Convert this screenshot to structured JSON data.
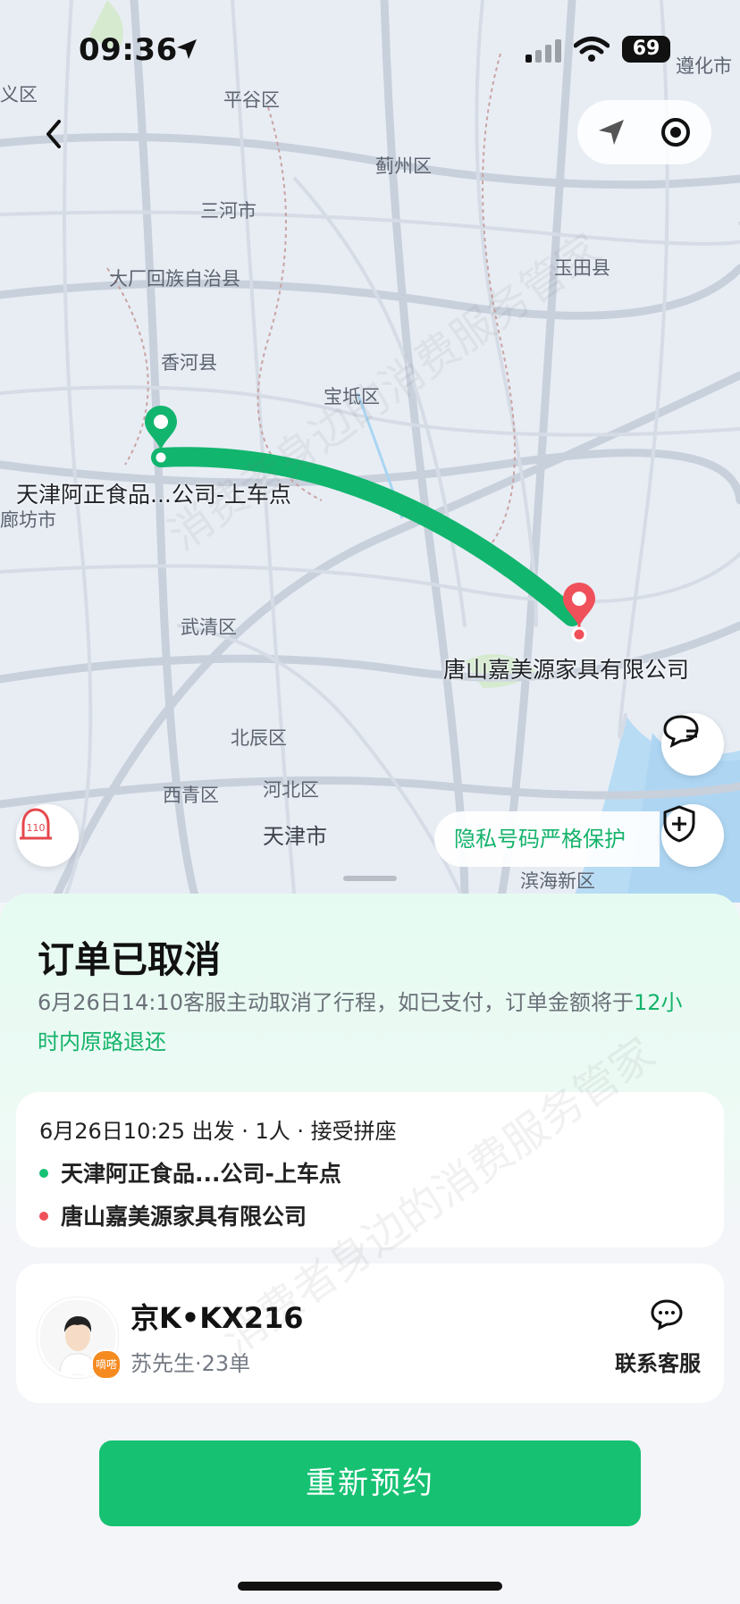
{
  "status_bar": {
    "time": "09:36",
    "battery": "69"
  },
  "map": {
    "labels": [
      "遵化市",
      "平谷区",
      "蓟州区",
      "三河市",
      "玉田县",
      "大厂回族自治县",
      "香河县",
      "宝坻区",
      "武清区",
      "北辰区",
      "西青区",
      "河北区",
      "天津市",
      "滨海新区",
      "义区",
      "廊坊市"
    ],
    "pickup_label": "天津阿正食品...公司-上车点",
    "dropoff_label": "唐山嘉美源家具有限公司",
    "privacy_text": "隐私号码严格保护",
    "police_badge": "110"
  },
  "order": {
    "title": "订单已取消",
    "desc_main": "6月26日14:10客服主动取消了行程，如已支付，订单金额将于",
    "desc_highlight": "12小时内原路退还"
  },
  "trip": {
    "summary": "6月26日10:25 出发 · 1人 · 接受拼座",
    "from": "天津阿正食品...公司-上车点",
    "to": "唐山嘉美源家具有限公司"
  },
  "driver": {
    "plate": "京K•KX216",
    "sub": "苏先生·23单",
    "badge": "嘀嗒",
    "contact_label": "联系客服"
  },
  "actions": {
    "rebook": "重新预约"
  },
  "watermark": "消费者身边的消费服务管家",
  "colors": {
    "accent": "#16c172",
    "route": "#12b56e",
    "dropoff_pin": "#f0505a"
  }
}
